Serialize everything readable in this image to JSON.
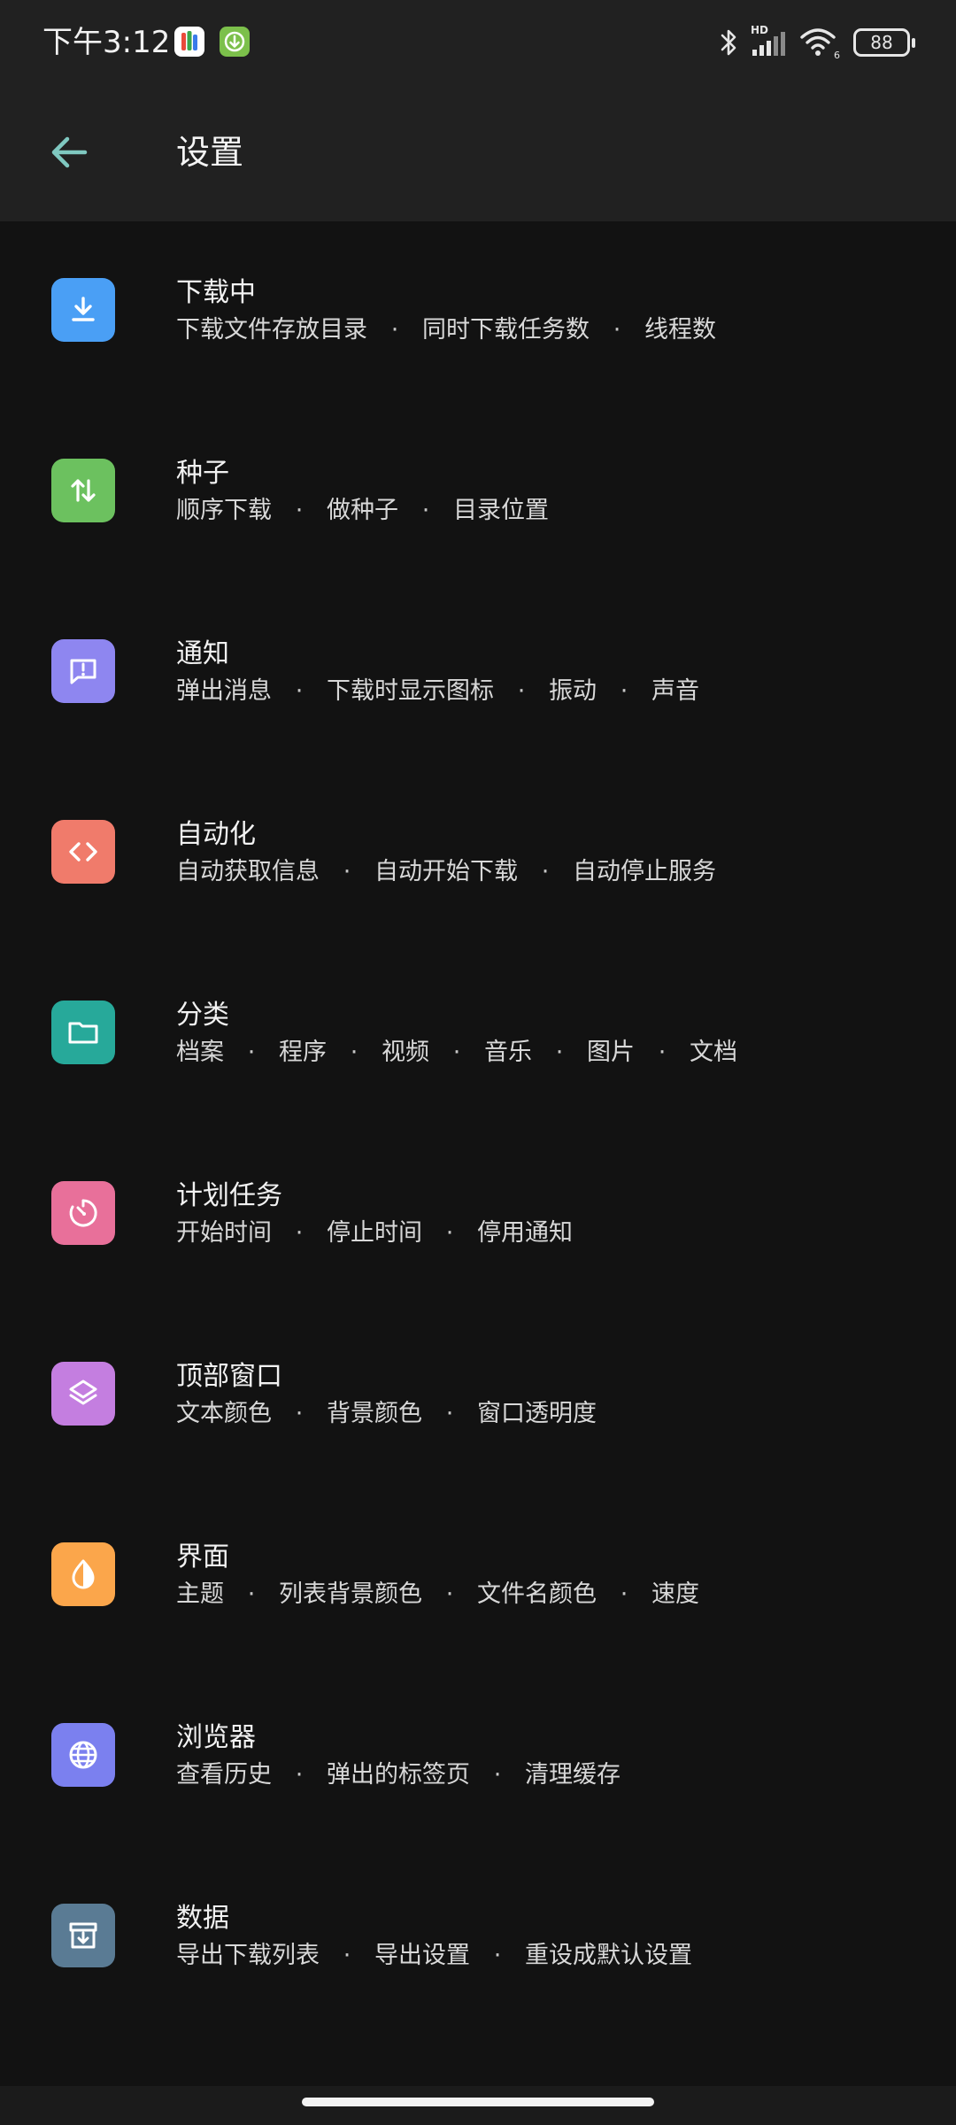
{
  "status_bar": {
    "time": "下午3:12",
    "battery": "88",
    "signal_label": "HD",
    "wifi_label": "6"
  },
  "app_bar": {
    "title": "设置"
  },
  "colors": {
    "accent_back_arrow": "#7fc8c0",
    "download": "#4a9ff5",
    "torrent": "#6cc15f",
    "notification": "#8e86f0",
    "automation": "#f07b6b",
    "category": "#27a99a",
    "schedule": "#e8709a",
    "floating_window": "#c47ee0",
    "interface": "#fba64b",
    "browser": "#7b80ef",
    "data": "#5a7b94"
  },
  "settings": [
    {
      "icon": "download-icon",
      "color": "#4a9ff5",
      "title": "下载中",
      "options": [
        "下载文件存放目录",
        "同时下载任务数",
        "线程数"
      ]
    },
    {
      "icon": "swap-vertical-icon",
      "color": "#6cc15f",
      "title": "种子",
      "options": [
        "顺序下载",
        "做种子",
        "目录位置"
      ]
    },
    {
      "icon": "message-alert-icon",
      "color": "#8e86f0",
      "title": "通知",
      "options": [
        "弹出消息",
        "下载时显示图标",
        "振动",
        "声音"
      ]
    },
    {
      "icon": "code-icon",
      "color": "#f07b6b",
      "title": "自动化",
      "options": [
        "自动获取信息",
        "自动开始下载",
        "自动停止服务"
      ]
    },
    {
      "icon": "folder-icon",
      "color": "#27a99a",
      "title": "分类",
      "options": [
        "档案",
        "程序",
        "视频",
        "音乐",
        "图片",
        "文档"
      ]
    },
    {
      "icon": "timer-icon",
      "color": "#e8709a",
      "title": "计划任务",
      "options": [
        "开始时间",
        "停止时间",
        "停用通知"
      ]
    },
    {
      "icon": "layers-icon",
      "color": "#c47ee0",
      "title": "顶部窗口",
      "options": [
        "文本颜色",
        "背景颜色",
        "窗口透明度"
      ]
    },
    {
      "icon": "contrast-icon",
      "color": "#fba64b",
      "title": "界面",
      "options": [
        "主题",
        "列表背景颜色",
        "文件名颜色",
        "速度"
      ]
    },
    {
      "icon": "globe-icon",
      "color": "#7b80ef",
      "title": "浏览器",
      "options": [
        "查看历史",
        "弹出的标签页",
        "清理缓存"
      ]
    },
    {
      "icon": "archive-download-icon",
      "color": "#5a7b94",
      "title": "数据",
      "options": [
        "导出下载列表",
        "导出设置",
        "重设成默认设置"
      ]
    }
  ]
}
